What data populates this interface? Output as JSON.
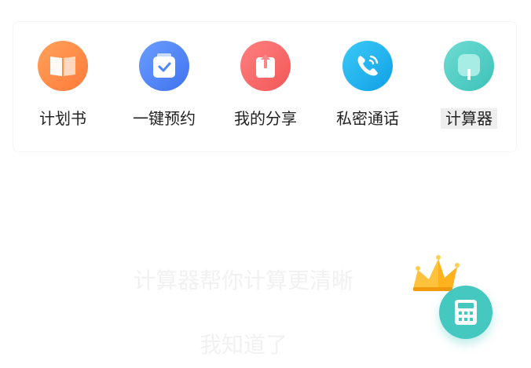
{
  "tools": [
    {
      "label": "计划书",
      "icon": "open-book-icon",
      "color": "#ff8a45"
    },
    {
      "label": "一键预约",
      "icon": "calendar-check-icon",
      "color": "#4f86f7"
    },
    {
      "label": "我的分享",
      "icon": "share-card-icon",
      "color": "#fa6a6a"
    },
    {
      "label": "私密通话",
      "icon": "phone-icon",
      "color": "#1eb0ef"
    },
    {
      "label": "计算器",
      "icon": "calculator-icon",
      "color": "#45c8c0"
    }
  ],
  "guide": {
    "tip_text": "计算器帮你计算更清晰",
    "dismiss_label": "我知道了",
    "fab_icon": "calculator-icon",
    "decoration_icon": "crown-icon"
  }
}
